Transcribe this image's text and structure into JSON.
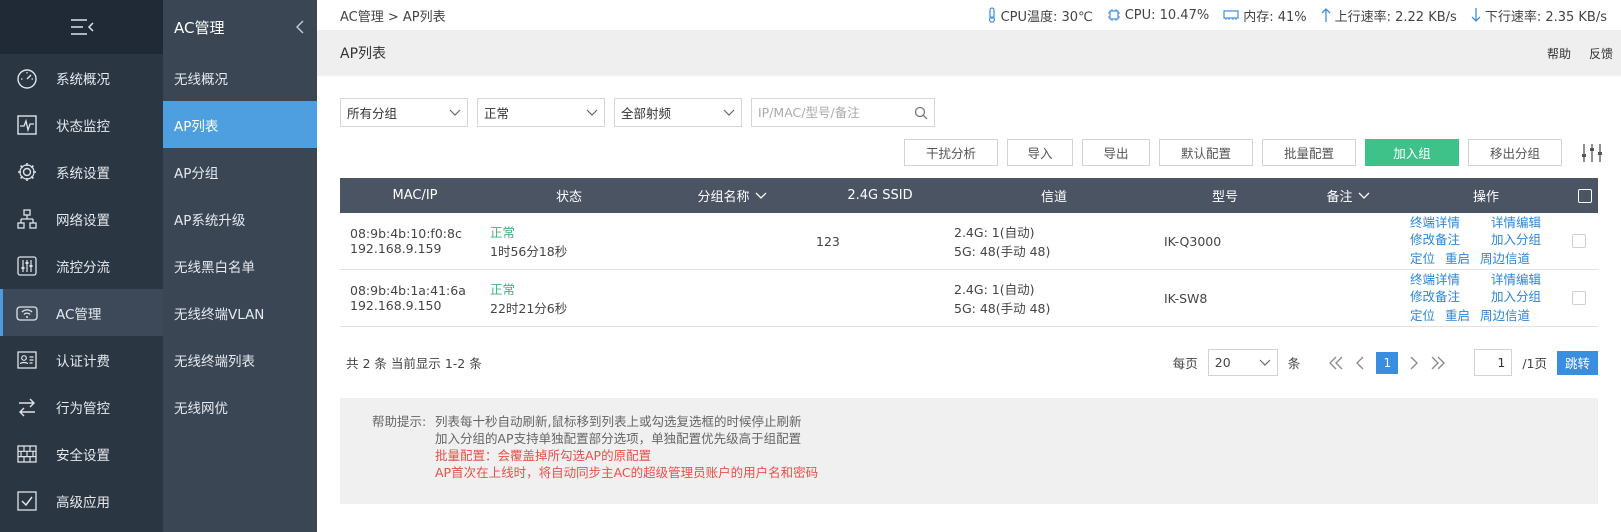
{
  "colors": {
    "sidebar": "#2b3643",
    "sidebar2": "#3a4654",
    "accent": "#4d9fe0",
    "green": "#3fc28a",
    "status_ok": "#3fb37e",
    "warn": "#e8514a"
  },
  "nav1": {
    "collapse_icon": "menu-collapse-icon",
    "items": [
      {
        "label": "系统概况",
        "icon": "dashboard-icon"
      },
      {
        "label": "状态监控",
        "icon": "monitor-icon"
      },
      {
        "label": "系统设置",
        "icon": "gear-icon"
      },
      {
        "label": "网络设置",
        "icon": "network-icon"
      },
      {
        "label": "流控分流",
        "icon": "sliders-icon"
      },
      {
        "label": "AC管理",
        "icon": "wifi-router-icon",
        "active": true
      },
      {
        "label": "认证计费",
        "icon": "id-card-icon"
      },
      {
        "label": "行为管控",
        "icon": "arrows-swap-icon"
      },
      {
        "label": "安全设置",
        "icon": "firewall-icon"
      },
      {
        "label": "高级应用",
        "icon": "check-square-icon"
      }
    ]
  },
  "nav2": {
    "title": "AC管理",
    "items": [
      {
        "label": "无线概况"
      },
      {
        "label": "AP列表",
        "active": true
      },
      {
        "label": "AP分组"
      },
      {
        "label": "AP系统升级"
      },
      {
        "label": "无线黑白名单"
      },
      {
        "label": "无线终端VLAN"
      },
      {
        "label": "无线终端列表"
      },
      {
        "label": "无线网优"
      }
    ]
  },
  "topbar": {
    "breadcrumb": "AC管理 > AP列表",
    "cpu_temp": "CPU温度: 30℃",
    "cpu": "CPU: 10.47%",
    "memory": "内存: 41%",
    "upload": "上行速率: 2.22 KB/s",
    "download": "下行速率: 2.35 KB/s"
  },
  "titlebar": {
    "title": "AP列表",
    "help": "帮助",
    "feedback": "反馈"
  },
  "filters": {
    "group": "所有分组",
    "status": "正常",
    "band": "全部射频",
    "search_placeholder": "IP/MAC/型号/备注"
  },
  "actions": [
    "干扰分析",
    "导入",
    "导出",
    "默认配置",
    "批量配置",
    "加入组",
    "移出分组"
  ],
  "table": {
    "headers": [
      "MAC/IP",
      "状态",
      "分组名称",
      "2.4G SSID",
      "信道",
      "型号",
      "备注",
      "操作"
    ],
    "rows": [
      {
        "mac": "08:9b:4b:10:f0:8c",
        "ip": "192.168.9.159",
        "status": "正常",
        "uptime": "1时56分18秒",
        "group": "",
        "ssid": "123",
        "ch24": "2.4G: 1(自动)",
        "ch5": "5G: 48(手动 48)",
        "model": "IK-Q3000",
        "note": ""
      },
      {
        "mac": "08:9b:4b:1a:41:6a",
        "ip": "192.168.9.150",
        "status": "正常",
        "uptime": "22时21分6秒",
        "group": "",
        "ssid": "",
        "ch24": "2.4G: 1(自动)",
        "ch5": "5G: 48(手动 48)",
        "model": "IK-SW8",
        "note": ""
      }
    ],
    "ops": [
      "终端详情",
      "详情编辑",
      "修改备注",
      "加入分组",
      "定位",
      "重启",
      "周边信道"
    ]
  },
  "footer": {
    "summary": "共 2 条 当前显示 1-2 条",
    "per_page_label": "每页",
    "per_page": "20",
    "unit": "条",
    "current_page": "1",
    "goto_value": "1",
    "total_pages": "/1页",
    "jump": "跳转"
  },
  "help": {
    "label": "帮助提示:",
    "lines": [
      "列表每十秒自动刷新,鼠标移到列表上或勾选复选框的时候停止刷新",
      "加入分组的AP支持单独配置部分选项，单独配置优先级高于组配置"
    ],
    "warnings": [
      "批量配置：会覆盖掉所勾选AP的原配置",
      "AP首次在上线时，将自动同步主AC的超级管理员账户的用户名和密码"
    ]
  }
}
